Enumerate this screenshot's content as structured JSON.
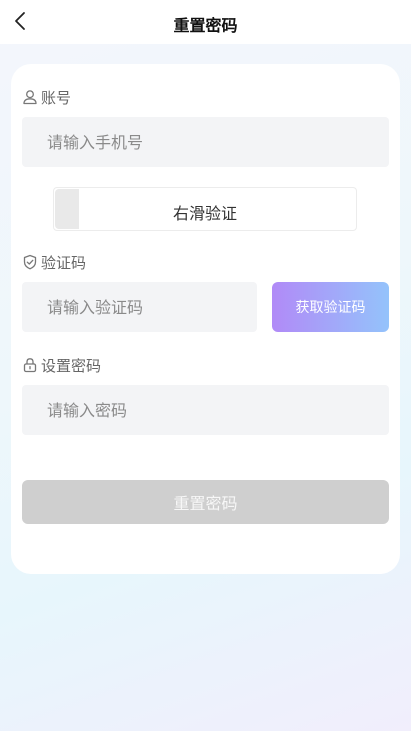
{
  "header": {
    "title": "重置密码",
    "back_icon": "chevron-left-icon"
  },
  "form": {
    "account": {
      "label": "账号",
      "icon": "user-icon",
      "placeholder": "请输入手机号"
    },
    "slider_captcha": {
      "text": "右滑验证",
      "progress": 0
    },
    "code": {
      "label": "验证码",
      "icon": "shield-icon",
      "placeholder": "请输入验证码",
      "get_code_label": "获取验证码"
    },
    "password": {
      "label": "设置密码",
      "icon": "lock-icon",
      "placeholder": "请输入密码"
    },
    "submit_label": "重置密码"
  },
  "colors": {
    "button_gradient_start": "#b18af7",
    "button_gradient_end": "#94c3fb",
    "submit_disabled": "#cfcfcf",
    "input_bg": "#f3f4f6"
  }
}
